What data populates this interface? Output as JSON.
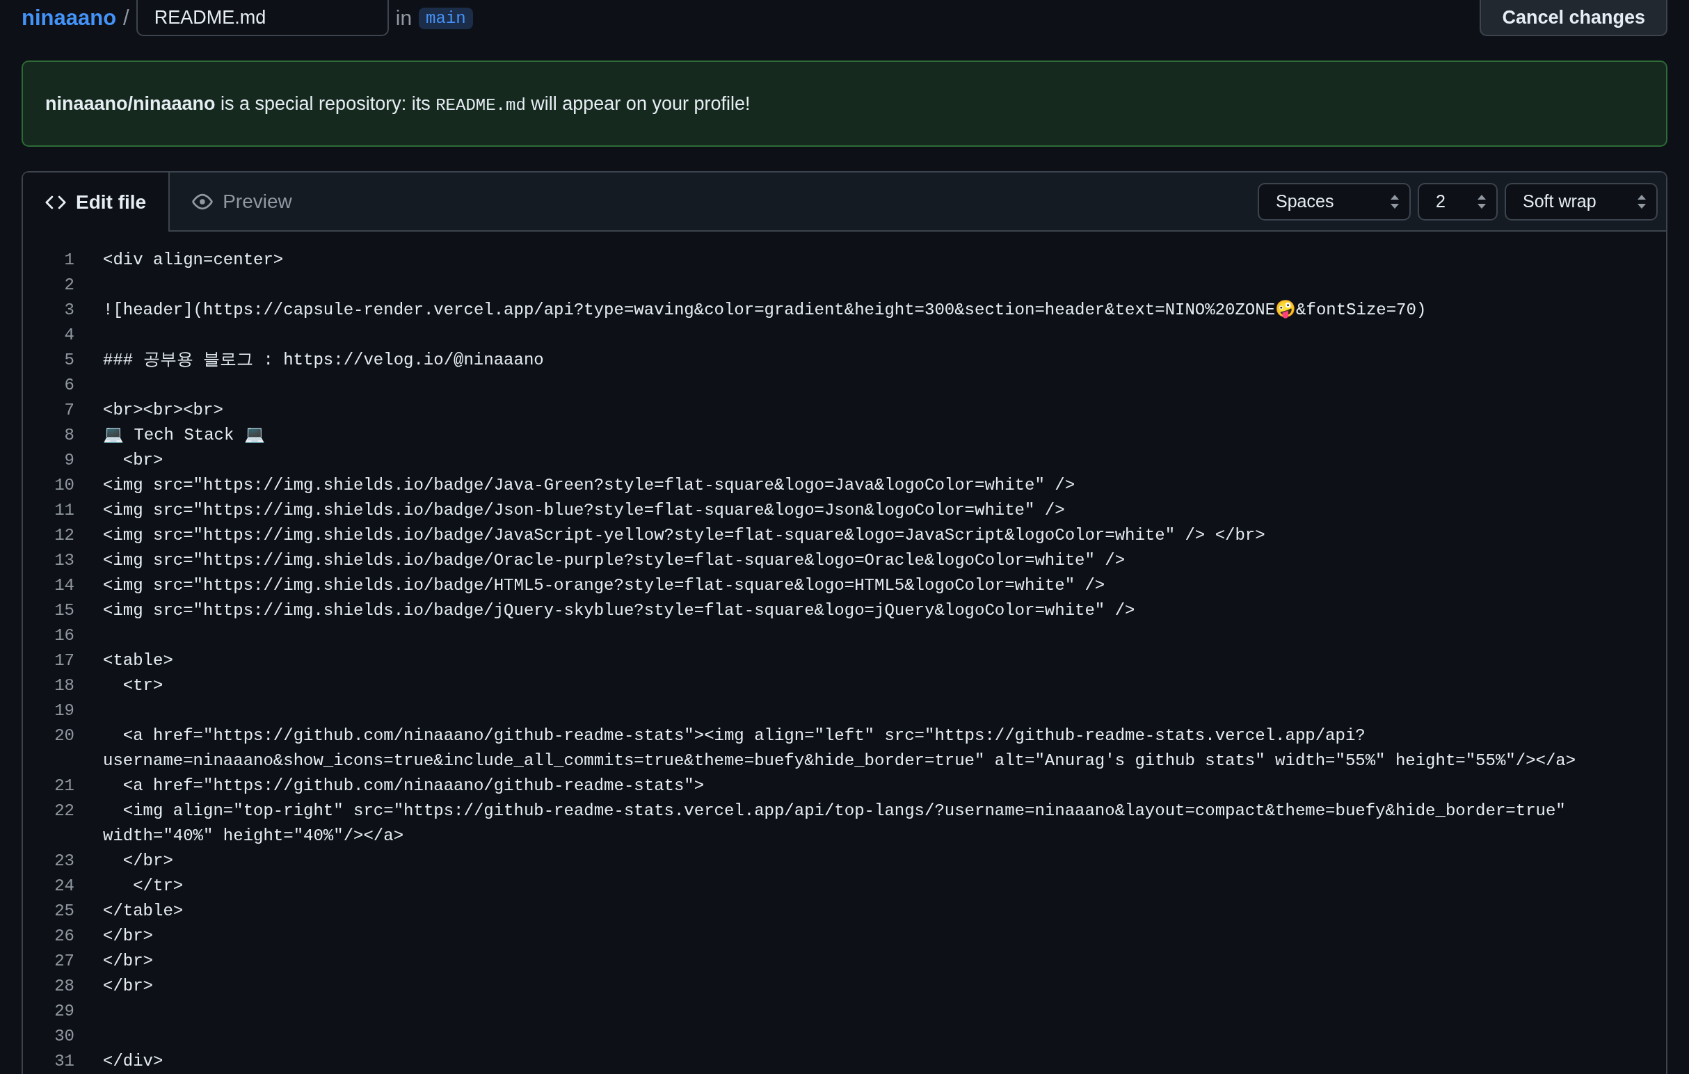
{
  "header": {
    "owner": "ninaaano",
    "separator": "/",
    "filename": "README.md",
    "in_label": "in",
    "branch": "main",
    "cancel_button": "Cancel changes"
  },
  "notice": {
    "text": "**ninaaano/ninaaano** is a special repository: its ",
    "code": "README.md",
    "suffix": " will appear on your profile!"
  },
  "tabs": [
    {
      "label": "Edit file",
      "selected": true
    },
    {
      "label": "Preview",
      "selected": false
    }
  ],
  "selects": [
    {
      "value": "Spaces",
      "kind": "wide"
    },
    {
      "value": "2",
      "kind": "narrow"
    },
    {
      "value": "Soft wrap",
      "kind": "wide"
    }
  ],
  "lines": [
    {
      "number": "1",
      "rows": [
        "<div align=center>"
      ]
    },
    {
      "number": "2"
    },
    {
      "number": "3",
      "rows": [
        "![header](https://capsule-render.vercel.app/api?type=waving&color=gradient&height=300&section=header&text=NINO%20ZONE🤪&fontSize=70)"
      ]
    },
    {
      "number": "4"
    },
    {
      "number": "5",
      "rows": [
        "### 공부용 블로그 : https://velog.io/@ninaaano"
      ]
    },
    {
      "number": "6"
    },
    {
      "number": "7",
      "rows": [
        "<br><br><br>"
      ]
    },
    {
      "number": "8",
      "rows": [
        "💻 Tech Stack 💻"
      ]
    },
    {
      "number": "9",
      "rows": [
        "  <br>"
      ]
    },
    {
      "number": "10",
      "rows": [
        "<img src=\"https://img.shields.io/badge/Java-Green?style=flat-square&logo=Java&logoColor=white\" />"
      ]
    },
    {
      "number": "11",
      "rows": [
        "<img src=\"https://img.shields.io/badge/Json-blue?style=flat-square&logo=Json&logoColor=white\" />"
      ]
    },
    {
      "number": "12",
      "rows": [
        "<img src=\"https://img.shields.io/badge/JavaScript-yellow?style=flat-square&logo=JavaScript&logoColor=white\" /> </br>"
      ]
    },
    {
      "number": "13",
      "rows": [
        "<img src=\"https://img.shields.io/badge/Oracle-purple?style=flat-square&logo=Oracle&logoColor=white\" />"
      ]
    },
    {
      "number": "14",
      "rows": [
        "<img src=\"https://img.shields.io/badge/HTML5-orange?style=flat-square&logo=HTML5&logoColor=white\" />"
      ]
    },
    {
      "number": "15",
      "rows": [
        "<img src=\"https://img.shields.io/badge/jQuery-skyblue?style=flat-square&logo=jQuery&logoColor=white\" />"
      ]
    },
    {
      "number": "16"
    },
    {
      "number": "17",
      "rows": [
        "<table>"
      ]
    },
    {
      "number": "18",
      "rows": [
        "  <tr>"
      ]
    },
    {
      "number": "19"
    },
    {
      "number": "20",
      "rows": [
        "  <a href=\"https://github.com/ninaaano/github-readme-stats\"><img align=\"left\" src=\"https://github-readme-stats.vercel.app/api?",
        "username=ninaaano&show_icons=true&include_all_commits=true&theme=buefy&hide_border=true\" alt=\"Anurag's github stats\" width=\"55%\" height=\"55%\"/></a>"
      ]
    },
    {
      "number": "21",
      "rows": [
        "  <a href=\"https://github.com/ninaaano/github-readme-stats\">"
      ]
    },
    {
      "number": "22",
      "rows": [
        "  <img align=\"top-right\" src=\"https://github-readme-stats.vercel.app/api/top-langs/?username=ninaaano&layout=compact&theme=buefy&hide_border=true\"",
        "width=\"40%\" height=\"40%\"/></a>"
      ]
    },
    {
      "number": "23",
      "rows": [
        "  </br>"
      ]
    },
    {
      "number": "24",
      "rows": [
        "   </tr>"
      ]
    },
    {
      "number": "25",
      "rows": [
        "</table>"
      ]
    },
    {
      "number": "26",
      "rows": [
        "</br>"
      ]
    },
    {
      "number": "27",
      "rows": [
        "</br>"
      ]
    },
    {
      "number": "28",
      "rows": [
        "</br>"
      ]
    },
    {
      "number": "29"
    },
    {
      "number": "30"
    },
    {
      "number": "31",
      "rows": [
        "</div>"
      ]
    }
  ]
}
